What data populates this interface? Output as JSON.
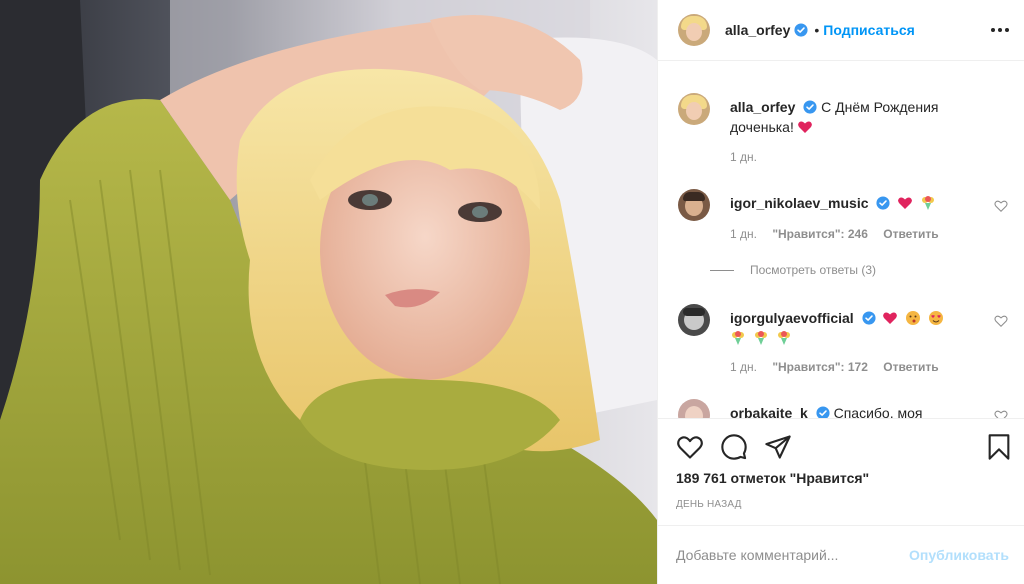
{
  "header": {
    "username": "alla_orfey",
    "dot": "•",
    "follow_label": "Подписаться",
    "more_icon": "more-horizontal-icon"
  },
  "caption": {
    "username": "alla_orfey",
    "text": "С Днём Рождения доченька!",
    "time": "1 дн."
  },
  "comments": [
    {
      "username": "igor_nikolaev_music",
      "time": "1 дн.",
      "likes": "\"Нравится\": 246",
      "reply_label": "Ответить",
      "view_replies": "Посмотреть ответы (3)"
    },
    {
      "username": "igorgulyaevofficial",
      "time": "1 дн.",
      "likes": "\"Нравится\": 172",
      "reply_label": "Ответить"
    },
    {
      "username": "orbakaite_k",
      "text": "Спасибо, моя"
    }
  ],
  "actions": {
    "like_icon": "heart-icon",
    "comment_icon": "comment-icon",
    "share_icon": "share-icon",
    "save_icon": "bookmark-icon"
  },
  "likes_text": "189 761 отметок \"Нравится\"",
  "timestamp": "ДЕНЬ НАЗАД",
  "add_comment": {
    "placeholder": "Добавьте комментарий...",
    "post_label": "Опубликовать"
  },
  "colors": {
    "accent": "#0095f6",
    "post_disabled": "#b2dffc",
    "muted": "#8e8e8e",
    "heart": "#ed4956"
  }
}
